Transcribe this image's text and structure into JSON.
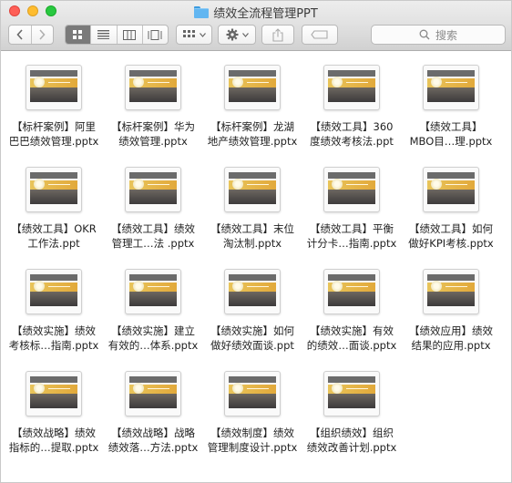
{
  "window": {
    "title": "绩效全流程管理PPT",
    "colors": {
      "close": "#fe5f57",
      "minimize": "#febc2e",
      "zoom": "#28c840",
      "folder": "#62b6f1"
    }
  },
  "toolbar": {
    "back_icon": "chevron-left-icon",
    "forward_icon": "chevron-right-icon",
    "view_modes": [
      "icon-view-icon",
      "list-view-icon",
      "column-view-icon",
      "gallery-view-icon"
    ],
    "active_view": "icon-view-icon",
    "arrange_icon": "grid-arrange-icon",
    "action_icon": "gear-icon",
    "share_icon": "share-icon",
    "tag_icon": "tag-icon",
    "search_placeholder": "搜索"
  },
  "files": [
    {
      "line1": "【标杆案例】阿里",
      "line2": "巴巴绩效管理.pptx"
    },
    {
      "line1": "【标杆案例】华为",
      "line2": "绩效管理.pptx"
    },
    {
      "line1": "【标杆案例】龙湖",
      "line2": "地产绩效管理.pptx"
    },
    {
      "line1": "【绩效工具】360",
      "line2": "度绩效考核法.ppt"
    },
    {
      "line1": "【绩效工具】",
      "line2": "MBO目…理.pptx"
    },
    {
      "line1": "【绩效工具】OKR",
      "line2": "工作法.ppt"
    },
    {
      "line1": "【绩效工具】绩效",
      "line2": "管理工…法 .pptx"
    },
    {
      "line1": "【绩效工具】末位",
      "line2": "淘汰制.pptx"
    },
    {
      "line1": "【绩效工具】平衡",
      "line2": "计分卡…指南.pptx"
    },
    {
      "line1": "【绩效工具】如何",
      "line2": "做好KPI考核.pptx"
    },
    {
      "line1": "【绩效实施】绩效",
      "line2": "考核标…指南.pptx"
    },
    {
      "line1": "【绩效实施】建立",
      "line2": "有效的…体系.pptx"
    },
    {
      "line1": "【绩效实施】如何",
      "line2": "做好绩效面谈.ppt"
    },
    {
      "line1": "【绩效实施】有效",
      "line2": "的绩效…面谈.pptx"
    },
    {
      "line1": "【绩效应用】绩效",
      "line2": "结果的应用.pptx"
    },
    {
      "line1": "【绩效战略】绩效",
      "line2": "指标的…提取.pptx"
    },
    {
      "line1": "【绩效战略】战略",
      "line2": "绩效落…方法.pptx"
    },
    {
      "line1": "【绩效制度】绩效",
      "line2": "管理制度设计.pptx"
    },
    {
      "line1": "【组织绩效】组织",
      "line2": "绩效改善计划.pptx"
    }
  ]
}
